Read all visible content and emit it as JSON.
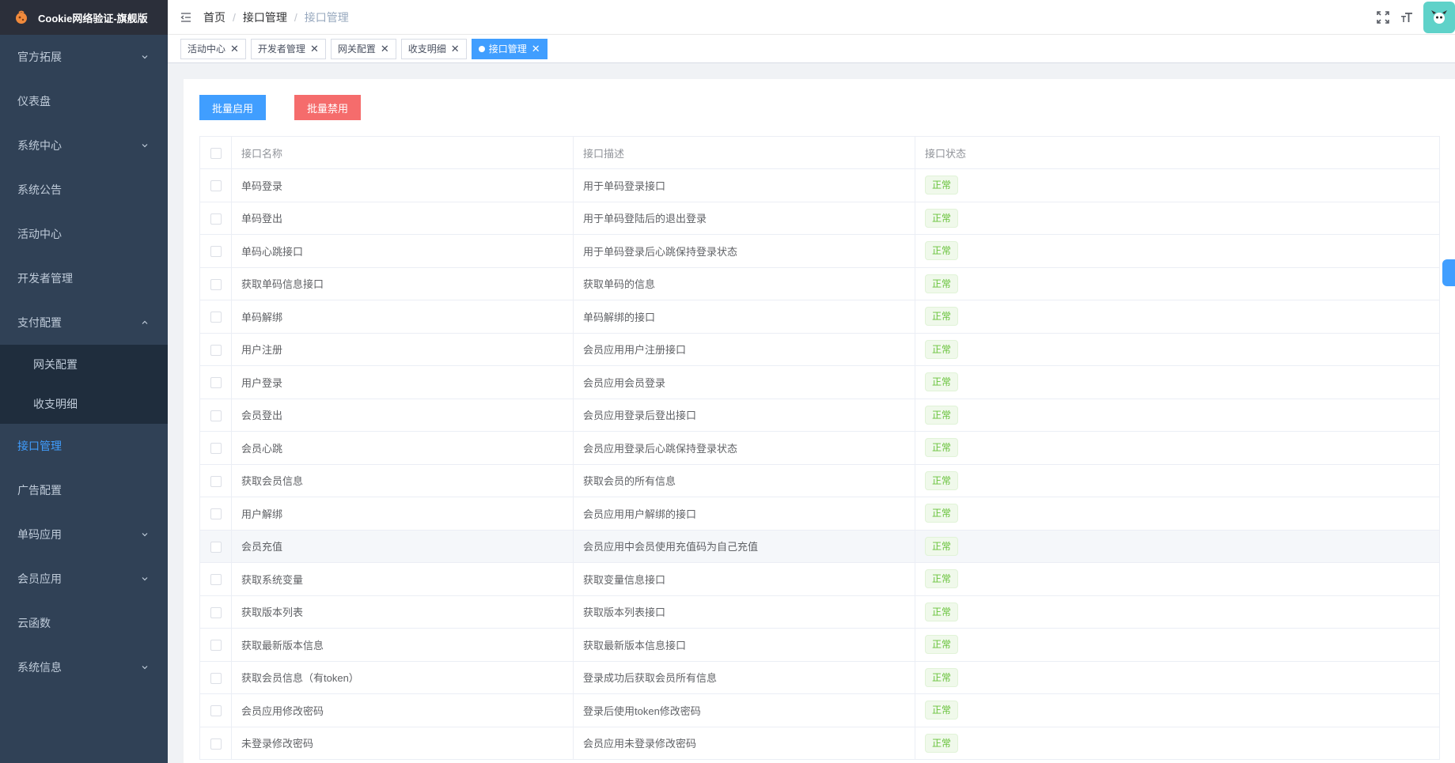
{
  "app": {
    "title": "Cookie网络验证-旗舰版"
  },
  "sidebar": {
    "items": [
      {
        "label": "官方拓展",
        "expandable": true
      },
      {
        "label": "仪表盘",
        "expandable": false
      },
      {
        "label": "系统中心",
        "expandable": true
      },
      {
        "label": "系统公告",
        "expandable": false
      },
      {
        "label": "活动中心",
        "expandable": false
      },
      {
        "label": "开发者管理",
        "expandable": false
      },
      {
        "label": "支付配置",
        "expandable": true,
        "expanded": true,
        "children": [
          {
            "label": "网关配置"
          },
          {
            "label": "收支明细"
          }
        ]
      },
      {
        "label": "接口管理",
        "expandable": false,
        "active": true
      },
      {
        "label": "广告配置",
        "expandable": false
      },
      {
        "label": "单码应用",
        "expandable": true
      },
      {
        "label": "会员应用",
        "expandable": true
      },
      {
        "label": "云函数",
        "expandable": false
      },
      {
        "label": "系统信息",
        "expandable": true
      }
    ]
  },
  "breadcrumb": [
    "首页",
    "接口管理",
    "接口管理"
  ],
  "tags": [
    {
      "label": "活动中心",
      "active": false
    },
    {
      "label": "开发者管理",
      "active": false
    },
    {
      "label": "网关配置",
      "active": false
    },
    {
      "label": "收支明细",
      "active": false
    },
    {
      "label": "接口管理",
      "active": true
    }
  ],
  "toolbar": {
    "enable_label": "批量启用",
    "disable_label": "批量禁用"
  },
  "table": {
    "columns": [
      "接口名称",
      "接口描述",
      "接口状态"
    ],
    "rows": [
      {
        "name": "单码登录",
        "desc": "用于单码登录接口",
        "status": "正常"
      },
      {
        "name": "单码登出",
        "desc": "用于单码登陆后的退出登录",
        "status": "正常"
      },
      {
        "name": "单码心跳接口",
        "desc": "用于单码登录后心跳保持登录状态",
        "status": "正常"
      },
      {
        "name": "获取单码信息接口",
        "desc": "获取单码的信息",
        "status": "正常"
      },
      {
        "name": "单码解绑",
        "desc": "单码解绑的接口",
        "status": "正常"
      },
      {
        "name": "用户注册",
        "desc": "会员应用用户注册接口",
        "status": "正常"
      },
      {
        "name": "用户登录",
        "desc": "会员应用会员登录",
        "status": "正常"
      },
      {
        "name": "会员登出",
        "desc": "会员应用登录后登出接口",
        "status": "正常"
      },
      {
        "name": "会员心跳",
        "desc": "会员应用登录后心跳保持登录状态",
        "status": "正常"
      },
      {
        "name": "获取会员信息",
        "desc": "获取会员的所有信息",
        "status": "正常"
      },
      {
        "name": "用户解绑",
        "desc": "会员应用用户解绑的接口",
        "status": "正常"
      },
      {
        "name": "会员充值",
        "desc": "会员应用中会员使用充值码为自己充值",
        "status": "正常"
      },
      {
        "name": "获取系统变量",
        "desc": "获取变量信息接口",
        "status": "正常"
      },
      {
        "name": "获取版本列表",
        "desc": "获取版本列表接口",
        "status": "正常"
      },
      {
        "name": "获取最新版本信息",
        "desc": "获取最新版本信息接口",
        "status": "正常"
      },
      {
        "name": "获取会员信息（有token）",
        "desc": "登录成功后获取会员所有信息",
        "status": "正常"
      },
      {
        "name": "会员应用修改密码",
        "desc": "登录后使用token修改密码",
        "status": "正常"
      },
      {
        "name": "未登录修改密码",
        "desc": "会员应用未登录修改密码",
        "status": "正常"
      }
    ]
  },
  "colors": {
    "sidebar_bg": "#304156",
    "primary": "#409eff",
    "danger": "#f56c6c",
    "success": "#67c23a"
  }
}
